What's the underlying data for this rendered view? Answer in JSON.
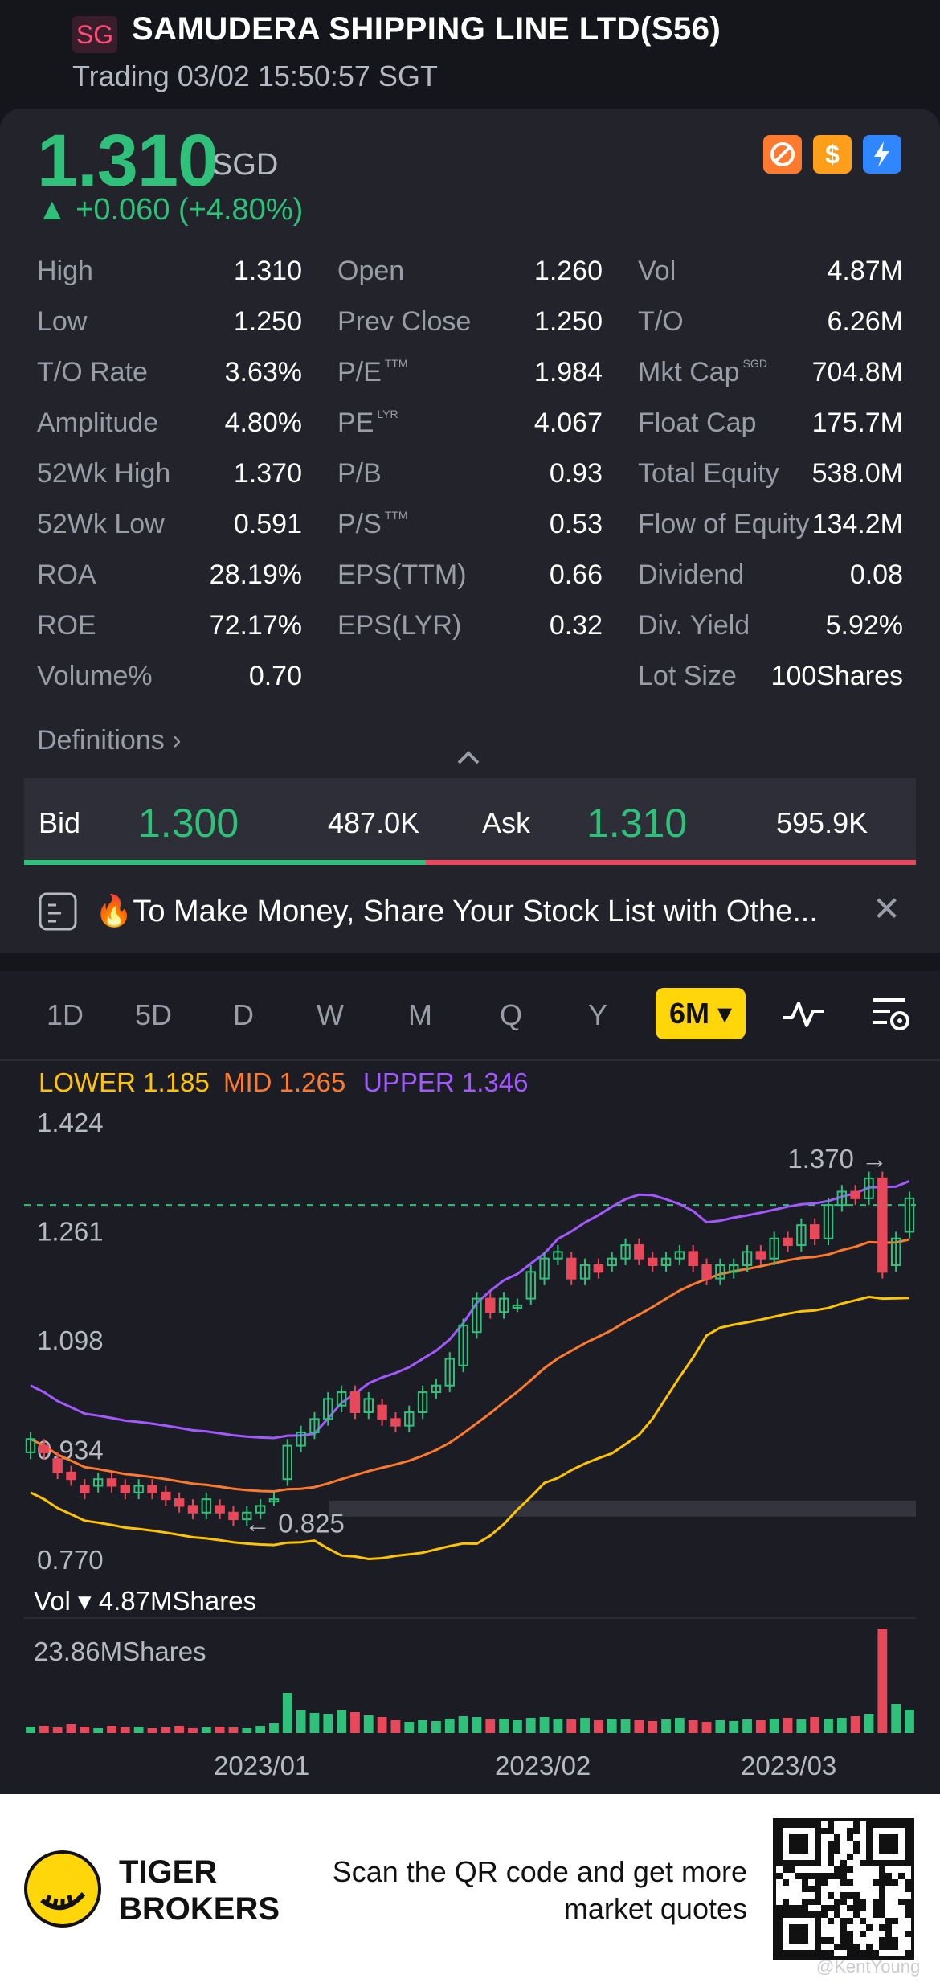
{
  "header": {
    "badge": "SG",
    "title": "SAMUDERA SHIPPING LINE LTD(S56)",
    "status": "Trading 03/02 15:50:57 SGT"
  },
  "quote": {
    "price": "1.310",
    "currency": "SGD",
    "change": "▲ +0.060 (+4.80%)",
    "icons": [
      "no-margin-icon",
      "dollar-icon",
      "lightning-icon"
    ]
  },
  "stats": {
    "col1": [
      {
        "label": "High",
        "value": "1.310"
      },
      {
        "label": "Low",
        "value": "1.250"
      },
      {
        "label": "T/O Rate",
        "value": "3.63%"
      },
      {
        "label": "Amplitude",
        "value": "4.80%"
      },
      {
        "label": "52Wk High",
        "value": "1.370"
      },
      {
        "label": "52Wk Low",
        "value": "0.591"
      },
      {
        "label": "ROA",
        "value": "28.19%"
      },
      {
        "label": "ROE",
        "value": "72.17%"
      },
      {
        "label": "Volume%",
        "value": "0.70"
      }
    ],
    "col2": [
      {
        "label": "Open",
        "value": "1.260"
      },
      {
        "label": "Prev Close",
        "value": "1.250"
      },
      {
        "label": "P/E",
        "value": "1.984",
        "sup": "TTM"
      },
      {
        "label": "PE",
        "value": "4.067",
        "sup": "LYR"
      },
      {
        "label": "P/B",
        "value": "0.93"
      },
      {
        "label": "P/S",
        "value": "0.53",
        "sup": "TTM"
      },
      {
        "label": "EPS(TTM)",
        "value": "0.66"
      },
      {
        "label": "EPS(LYR)",
        "value": "0.32"
      }
    ],
    "col3": [
      {
        "label": "Vol",
        "value": "4.87M"
      },
      {
        "label": "T/O",
        "value": "6.26M"
      },
      {
        "label": "Mkt Cap",
        "value": "704.8M",
        "sup": "SGD"
      },
      {
        "label": "Float Cap",
        "value": "175.7M"
      },
      {
        "label": "Total Equity",
        "value": "538.0M"
      },
      {
        "label": "Flow of Equity",
        "value": "134.2M"
      },
      {
        "label": "Dividend",
        "value": "0.08"
      },
      {
        "label": "Div. Yield",
        "value": "5.92%"
      },
      {
        "label": "Lot Size",
        "value": "100Shares"
      }
    ],
    "definitions": "Definitions ›"
  },
  "bidask": {
    "bid_label": "Bid",
    "bid_price": "1.300",
    "bid_vol": "487.0K",
    "ask_label": "Ask",
    "ask_price": "1.310",
    "ask_vol": "595.9K"
  },
  "promo": {
    "text": "🔥To Make Money, Share Your Stock List with Othe..."
  },
  "chart_tabs": [
    "1D",
    "5D",
    "D",
    "W",
    "M",
    "Q",
    "Y"
  ],
  "chart_tab_active": "6M",
  "indicators": {
    "lower": "LOWER 1.185",
    "mid": "MID 1.265",
    "upper": "UPPER 1.346"
  },
  "colors": {
    "up": "#2fc17a",
    "down": "#e9485a",
    "lower": "#ffc400",
    "mid": "#ff7a2e",
    "upper": "#a259ff",
    "accent": "#ffd60a"
  },
  "chart_data": {
    "type": "candlestick",
    "y_ticks": [
      "1.424",
      "1.261",
      "1.098",
      "0.934",
      "0.770"
    ],
    "ylim": [
      0.77,
      1.424
    ],
    "annotations": {
      "high_marker": "1.370",
      "low_marker": "0.825"
    },
    "x_labels": [
      "2023/01",
      "2023/02",
      "2023/03"
    ],
    "candles": [
      [
        0.93,
        0.95
      ],
      [
        0.94,
        0.93
      ],
      [
        0.92,
        0.9
      ],
      [
        0.9,
        0.89
      ],
      [
        0.88,
        0.87
      ],
      [
        0.88,
        0.89
      ],
      [
        0.89,
        0.88
      ],
      [
        0.88,
        0.87
      ],
      [
        0.87,
        0.88
      ],
      [
        0.88,
        0.87
      ],
      [
        0.87,
        0.86
      ],
      [
        0.86,
        0.85
      ],
      [
        0.85,
        0.84
      ],
      [
        0.84,
        0.86
      ],
      [
        0.85,
        0.84
      ],
      [
        0.84,
        0.83
      ],
      [
        0.83,
        0.84
      ],
      [
        0.84,
        0.85
      ],
      [
        0.86,
        0.86
      ],
      [
        0.89,
        0.94
      ],
      [
        0.94,
        0.96
      ],
      [
        0.96,
        0.98
      ],
      [
        0.98,
        1.01
      ],
      [
        1.0,
        1.02
      ],
      [
        1.02,
        0.99
      ],
      [
        0.99,
        1.01
      ],
      [
        1.0,
        0.98
      ],
      [
        0.98,
        0.97
      ],
      [
        0.97,
        0.99
      ],
      [
        0.99,
        1.02
      ],
      [
        1.02,
        1.03
      ],
      [
        1.03,
        1.07
      ],
      [
        1.06,
        1.12
      ],
      [
        1.11,
        1.16
      ],
      [
        1.16,
        1.14
      ],
      [
        1.14,
        1.16
      ],
      [
        1.15,
        1.15
      ],
      [
        1.16,
        1.2
      ],
      [
        1.19,
        1.22
      ],
      [
        1.22,
        1.23
      ],
      [
        1.22,
        1.19
      ],
      [
        1.19,
        1.21
      ],
      [
        1.21,
        1.2
      ],
      [
        1.21,
        1.22
      ],
      [
        1.22,
        1.24
      ],
      [
        1.24,
        1.22
      ],
      [
        1.22,
        1.21
      ],
      [
        1.21,
        1.22
      ],
      [
        1.22,
        1.23
      ],
      [
        1.23,
        1.21
      ],
      [
        1.21,
        1.19
      ],
      [
        1.19,
        1.21
      ],
      [
        1.2,
        1.21
      ],
      [
        1.21,
        1.23
      ],
      [
        1.23,
        1.22
      ],
      [
        1.22,
        1.25
      ],
      [
        1.25,
        1.24
      ],
      [
        1.24,
        1.27
      ],
      [
        1.27,
        1.25
      ],
      [
        1.25,
        1.3
      ],
      [
        1.3,
        1.32
      ],
      [
        1.32,
        1.31
      ],
      [
        1.31,
        1.34
      ],
      [
        1.34,
        1.2
      ],
      [
        1.21,
        1.25
      ],
      [
        1.26,
        1.31
      ]
    ],
    "volume_label": "Vol ▾ 4.87MShares",
    "volume_max": "23.86MShares",
    "volumes": [
      0.8,
      0.9,
      0.7,
      1.1,
      0.8,
      0.6,
      0.9,
      0.7,
      0.8,
      0.6,
      0.7,
      0.9,
      0.6,
      0.7,
      0.8,
      0.7,
      0.6,
      0.9,
      1.2,
      5.0,
      2.8,
      2.5,
      2.4,
      2.8,
      2.6,
      2.2,
      2.0,
      1.6,
      1.4,
      1.6,
      1.5,
      1.8,
      2.1,
      2.0,
      1.7,
      1.8,
      1.6,
      1.9,
      2.0,
      1.8,
      1.7,
      1.9,
      1.6,
      1.8,
      1.7,
      1.6,
      1.5,
      1.7,
      1.9,
      1.6,
      1.4,
      1.6,
      1.5,
      1.7,
      1.6,
      1.8,
      1.9,
      1.7,
      2.0,
      1.8,
      1.9,
      2.1,
      2.4,
      13.0,
      3.6,
      2.9
    ]
  },
  "footer": {
    "brand_line1": "TIGER",
    "brand_line2": "BROKERS",
    "scan_line1": "Scan the QR code and get more",
    "scan_line2": "market quotes",
    "watermark": "@KentYoung"
  }
}
